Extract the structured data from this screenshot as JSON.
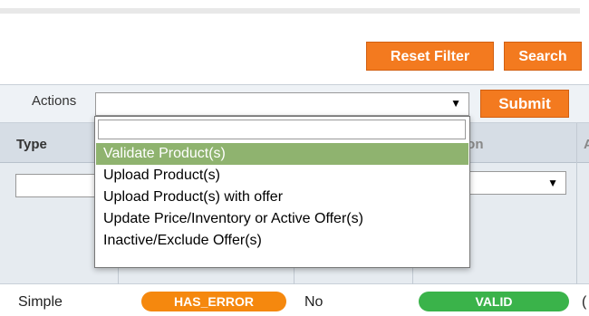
{
  "toolbar": {
    "reset_label": "Reset Filter",
    "search_label": "Search"
  },
  "actions": {
    "label": "Actions",
    "selected_value": "",
    "submit_label": "Submit",
    "dropdown_search_value": "",
    "options": [
      "Validate Product(s)",
      "Upload Product(s)",
      "Upload Product(s) with offer",
      "Update Price/Inventory or Active Offer(s)",
      "Inactive/Exclude Offer(s)"
    ]
  },
  "grid": {
    "headers": {
      "type": "Type",
      "action_partial": "tion",
      "extra_partial": "A"
    },
    "row": {
      "type": "Simple",
      "status_badge": "HAS_ERROR",
      "offer": "No",
      "validation_badge": "VALID",
      "extra": "("
    }
  },
  "colors": {
    "accent_orange": "#f37a1f",
    "error_badge": "#f5880e",
    "valid_badge": "#3ab34a",
    "selected_option": "#8fb36f"
  }
}
